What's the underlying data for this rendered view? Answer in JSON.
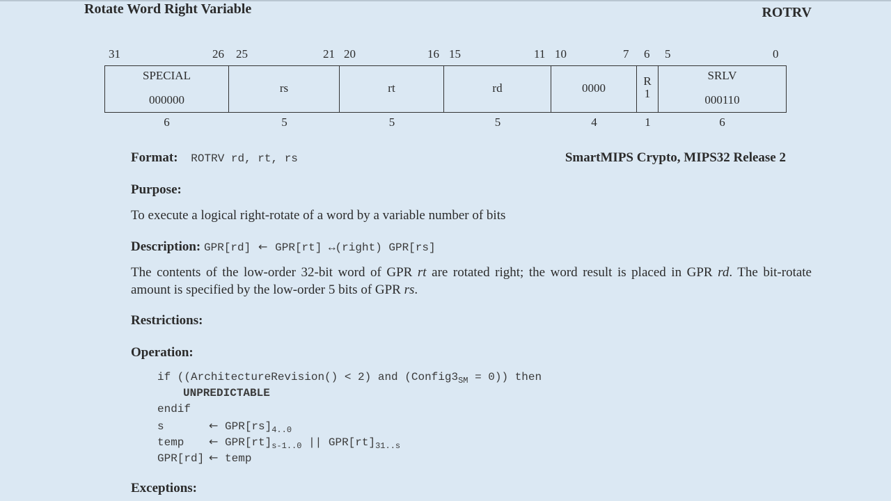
{
  "header": {
    "title": "Rotate Word Right Variable",
    "mnemonic": "ROTRV"
  },
  "encoding": {
    "bit_numbers": [
      "31",
      "26",
      "25",
      "21",
      "20",
      "16",
      "15",
      "11",
      "10",
      "7",
      "6",
      "5",
      "0"
    ],
    "fields": [
      {
        "name": "SPECIAL",
        "value": "000000",
        "width": "6"
      },
      {
        "name": "rs",
        "width": "5"
      },
      {
        "name": "rt",
        "width": "5"
      },
      {
        "name": "rd",
        "width": "5"
      },
      {
        "name": "0000",
        "width": "4"
      },
      {
        "name": "R",
        "value": "1",
        "width": "1"
      },
      {
        "name": "SRLV",
        "value": "000110",
        "width": "6"
      }
    ]
  },
  "format": {
    "label": "Format:",
    "syntax": "ROTRV rd, rt, rs",
    "arch": "SmartMIPS Crypto, MIPS32 Release 2"
  },
  "purpose": {
    "label": "Purpose:",
    "text": "To execute a logical right-rotate of a word by a variable number of bits"
  },
  "description": {
    "label": "Description:",
    "formula_lhs": "GPR[rd]",
    "formula_arrow": "←",
    "formula_op": "GPR[rt] ↔(right) GPR[rs]",
    "t1": "The contents of the low-order 32-bit word of GPR ",
    "rt": "rt",
    "t2": " are rotated right; the word result is placed in GPR ",
    "rd": "rd",
    "t3": ". The bit-rotate amount is specified by the low-order 5 bits of GPR ",
    "rs": "rs",
    "t4": "."
  },
  "restrictions": {
    "label": "Restrictions:"
  },
  "operation": {
    "label": "Operation:",
    "l1_a": "if ((ArchitectureRevision() < 2) and (Config3",
    "l1_sub": "SM",
    "l1_b": " = 0)) then",
    "l2": "UNPREDICTABLE",
    "l3": "endif",
    "l4_name": "s",
    "l4_expr": "GPR[rs]",
    "l4_sub": "4..0",
    "l5_name": "temp",
    "l5_a": "GPR[rt]",
    "l5_sub1": "s-1..0",
    "l5_cat": "||",
    "l5_b": "GPR[rt]",
    "l5_sub2": "31..s",
    "l6_name": "GPR[rd]",
    "l6_expr": "temp",
    "arrow": "←"
  },
  "exceptions": {
    "label": "Exceptions:"
  }
}
